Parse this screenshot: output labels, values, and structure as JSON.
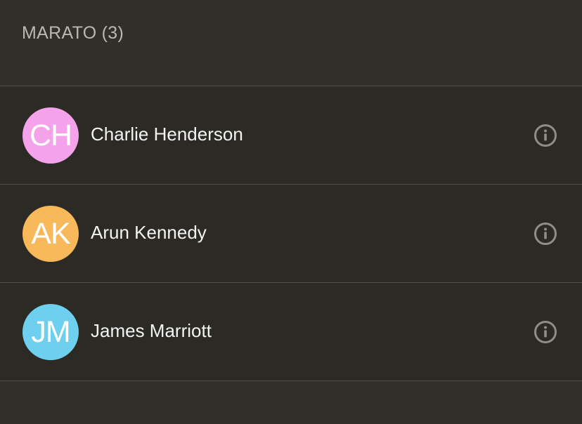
{
  "section": {
    "title": "MARATO (3)"
  },
  "contacts": [
    {
      "initials": "CH",
      "name": "Charlie Henderson",
      "avatar_color": "#f4a3ea",
      "icon": "info-icon"
    },
    {
      "initials": "AK",
      "name": "Arun Kennedy",
      "avatar_color": "#f8b95a",
      "icon": "info-icon"
    },
    {
      "initials": "JM",
      "name": "James Marriott",
      "avatar_color": "#6fcfee",
      "icon": "info-icon"
    }
  ],
  "colors": {
    "background": "#302f29",
    "row_background": "#2b2a25",
    "divider": "#4f4d46",
    "title_text": "#b9b8b3",
    "name_text": "#f3f3f1",
    "icon": "#8f8d88"
  }
}
